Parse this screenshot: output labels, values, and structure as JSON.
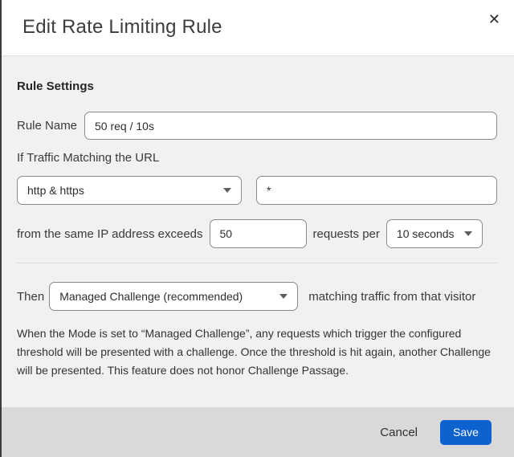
{
  "dialog": {
    "title": "Edit Rate Limiting Rule",
    "close_icon": "✕"
  },
  "form": {
    "section_heading": "Rule Settings",
    "rule_name": {
      "label": "Rule Name",
      "value": "50 req / 10s"
    },
    "url_match": {
      "label": "If Traffic Matching the URL",
      "scheme_selected": "http & https",
      "url_value": "*"
    },
    "threshold": {
      "prefix_label": "from the same IP address exceeds",
      "requests_value": "50",
      "middle_label": "requests per",
      "period_selected": "10 seconds"
    },
    "action": {
      "prefix_label": "Then",
      "mode_selected": "Managed Challenge (recommended)",
      "suffix_label": "matching traffic from that visitor"
    },
    "help_text": "When the Mode is set to “Managed Challenge”, any requests which trigger the configured threshold will be presented with a challenge. Once the threshold is hit again, another Challenge will be presented. This feature does not honor Challenge Passage."
  },
  "footer": {
    "cancel_label": "Cancel",
    "save_label": "Save"
  },
  "colors": {
    "accent_blue": "#0d62d0",
    "header_bg": "#ffffff",
    "body_bg": "#f1f1f1",
    "footer_bg": "#d9d9d9",
    "input_border": "#8b8b8b"
  }
}
